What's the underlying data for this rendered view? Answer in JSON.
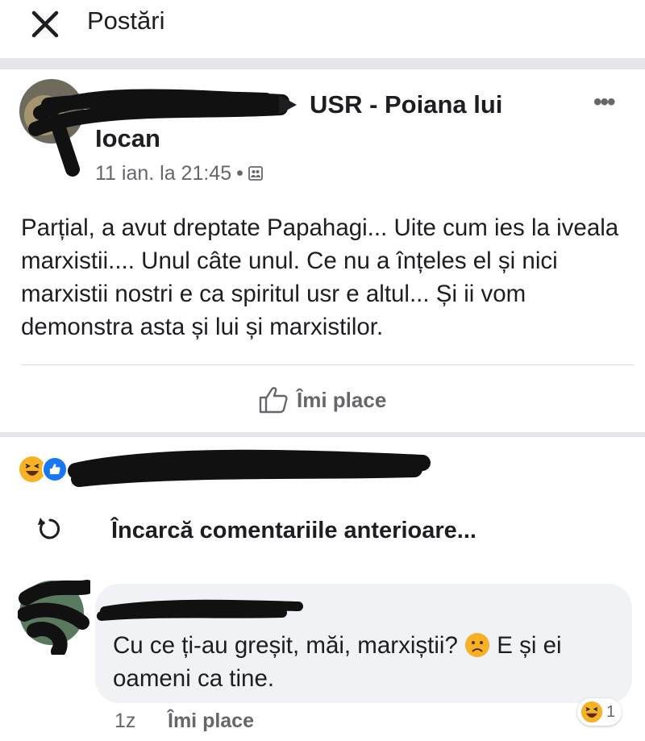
{
  "header": {
    "title": "Postări",
    "close_icon": "close-icon"
  },
  "post": {
    "group_name_line1": "USR - Poiana lui",
    "group_name_line2": "Iocan",
    "more_label": "•••",
    "timestamp": "11 ian. la 21:45",
    "separator": "•",
    "privacy_icon": "group-privacy-icon",
    "text": "Parțial, a avut dreptate Papahagi... Uite cum ies la iveala marxistii.... Unul câte unul. Ce nu a înțeles el și nici marxistii nostri e ca spiritul usr e altul... Și ii vom demonstra asta și lui și marxistilor.",
    "like_label": "Îmi place"
  },
  "reactions": {
    "icons": [
      "haha-reaction-icon",
      "like-reaction-icon"
    ]
  },
  "comments": {
    "load_previous_label": "Încarcă comentariile anterioare...",
    "items": [
      {
        "text_part1": "Cu ce ți-au greșit, măi, marxiștii?",
        "text_part2": "E și ei oameni ca tine.",
        "time": "1z",
        "like_label": "Îmi place",
        "reaction_count": "1"
      }
    ]
  },
  "colors": {
    "secondary_text": "#65676b",
    "divider": "#e4e6eb",
    "bubble": "#f0f2f5",
    "like_blue": "#1877f2",
    "haha_yellow": "#f7b125"
  }
}
